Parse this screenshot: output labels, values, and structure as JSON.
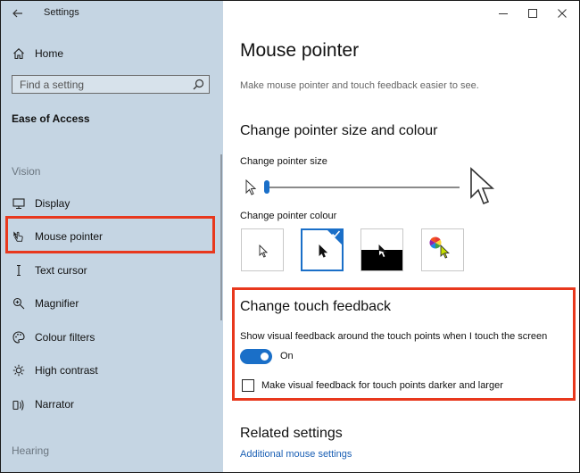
{
  "window": {
    "app_title": "Settings"
  },
  "sidebar": {
    "home_label": "Home",
    "search_placeholder": "Find a setting",
    "section_title": "Ease of Access",
    "group_vision": "Vision",
    "group_hearing": "Hearing",
    "items": [
      {
        "label": "Display",
        "icon": "display-icon"
      },
      {
        "label": "Mouse pointer",
        "icon": "mouse-pointer-icon",
        "selected": true
      },
      {
        "label": "Text cursor",
        "icon": "text-cursor-icon"
      },
      {
        "label": "Magnifier",
        "icon": "magnifier-icon"
      },
      {
        "label": "Colour filters",
        "icon": "colour-filters-icon"
      },
      {
        "label": "High contrast",
        "icon": "high-contrast-icon"
      },
      {
        "label": "Narrator",
        "icon": "narrator-icon"
      }
    ]
  },
  "main": {
    "title": "Mouse pointer",
    "description": "Make mouse pointer and touch feedback easier to see.",
    "pointer_section": {
      "heading": "Change pointer size and colour",
      "size_label": "Change pointer size",
      "size_value": 1,
      "colour_label": "Change pointer colour",
      "colour_options": [
        "white",
        "black",
        "inverted",
        "custom"
      ],
      "selected_colour": "black"
    },
    "touch_section": {
      "heading": "Change touch feedback",
      "feedback_label": "Show visual feedback around the touch points when I touch the screen",
      "toggle_state": "On",
      "checkbox_label": "Make visual feedback for touch points darker and larger",
      "checkbox_checked": false
    },
    "related": {
      "heading": "Related settings",
      "link_label": "Additional mouse settings"
    }
  },
  "colors": {
    "accent": "#1a6fc8",
    "highlight": "#e8381d",
    "sidebar_bg": "#c5d5e3",
    "link": "#1a5fb4"
  }
}
